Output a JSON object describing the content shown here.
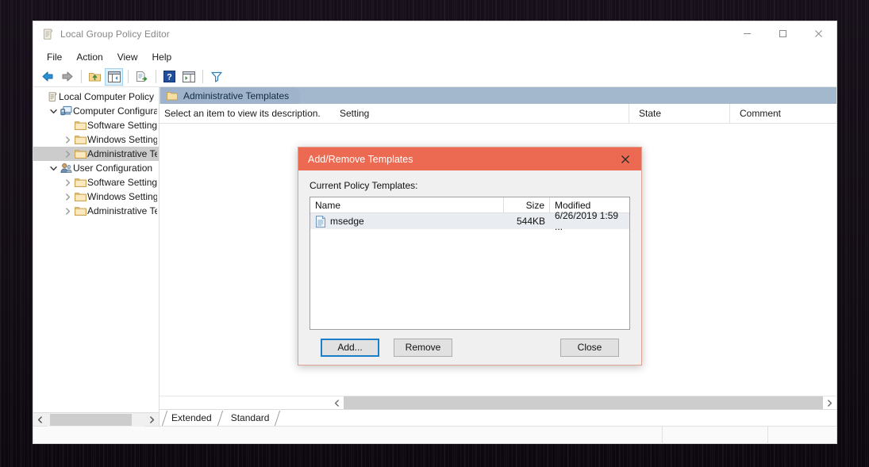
{
  "window": {
    "title": "Local Group Policy Editor",
    "title_icon": "policy-scroll-icon",
    "controls": {
      "minimize": "minimize-icon",
      "maximize": "maximize-icon",
      "close": "close-icon"
    }
  },
  "menubar": {
    "items": [
      "File",
      "Action",
      "View",
      "Help"
    ]
  },
  "toolbar": {
    "buttons": [
      {
        "name": "back-icon",
        "label": "Back"
      },
      {
        "name": "forward-icon",
        "label": "Forward"
      },
      {
        "name": "up-folder-icon",
        "label": "Up One Level"
      },
      {
        "name": "show-hide-tree-icon",
        "label": "Show/Hide Console Tree",
        "active": true
      },
      {
        "name": "export-list-icon",
        "label": "Export List"
      },
      {
        "name": "help-icon",
        "label": "Help"
      },
      {
        "name": "properties-icon",
        "label": "Properties"
      },
      {
        "name": "filter-icon",
        "label": "Filter"
      }
    ]
  },
  "tree": {
    "items": [
      {
        "label": "Local Computer Policy",
        "icon": "policy-scroll-icon",
        "indent": 0,
        "twisty": "none",
        "selected": false
      },
      {
        "label": "Computer Configura",
        "icon": "computer-icon",
        "indent": 1,
        "twisty": "expanded",
        "selected": false
      },
      {
        "label": "Software Settings",
        "icon": "folder-icon",
        "indent": 2,
        "twisty": "none",
        "selected": false
      },
      {
        "label": "Windows Setting",
        "icon": "folder-icon",
        "indent": 2,
        "twisty": "collapsed",
        "selected": false
      },
      {
        "label": "Administrative Te",
        "icon": "folder-icon",
        "indent": 2,
        "twisty": "collapsed",
        "selected": true
      },
      {
        "label": "User Configuration",
        "icon": "user-icon",
        "indent": 1,
        "twisty": "expanded",
        "selected": false
      },
      {
        "label": "Software Settings",
        "icon": "folder-icon",
        "indent": 2,
        "twisty": "collapsed",
        "selected": false
      },
      {
        "label": "Windows Setting",
        "icon": "folder-icon",
        "indent": 2,
        "twisty": "collapsed",
        "selected": false
      },
      {
        "label": "Administrative Te",
        "icon": "folder-icon",
        "indent": 2,
        "twisty": "collapsed",
        "selected": false
      }
    ],
    "hscroll": {
      "left_arrow": "chevron-left-icon",
      "right_arrow": "chevron-right-icon"
    }
  },
  "content": {
    "header_tab": "Administrative Templates",
    "header_tab_icon": "folder-icon",
    "description_placeholder": "Select an item to view its description.",
    "columns": [
      "Setting",
      "State",
      "Comment"
    ],
    "rows": [],
    "hscroll": {
      "left_arrow": "chevron-left-icon",
      "right_arrow": "chevron-right-icon"
    }
  },
  "view_tabs": [
    {
      "label": "Extended",
      "active": false
    },
    {
      "label": "Standard",
      "active": true
    }
  ],
  "statusbar": {
    "cells": [
      "",
      "",
      ""
    ]
  },
  "dialog": {
    "title": "Add/Remove Templates",
    "close_icon": "close-icon",
    "list_label": "Current Policy Templates:",
    "columns": [
      "Name",
      "Size",
      "Modified"
    ],
    "rows": [
      {
        "icon": "template-file-icon",
        "name": "msedge",
        "size": "544KB",
        "modified": "6/26/2019 1:59 ..."
      }
    ],
    "buttons": [
      {
        "label": "Add...",
        "focused": true
      },
      {
        "label": "Remove",
        "focused": false
      },
      {
        "label": "Close",
        "focused": false
      }
    ]
  },
  "colors": {
    "dialog_titlebar": "#ec6a52",
    "mmc_header": "#a3b7cd",
    "tree_selection": "#cccccc",
    "list_row": "#e9edf2",
    "focus_border": "#1a7ec8"
  }
}
